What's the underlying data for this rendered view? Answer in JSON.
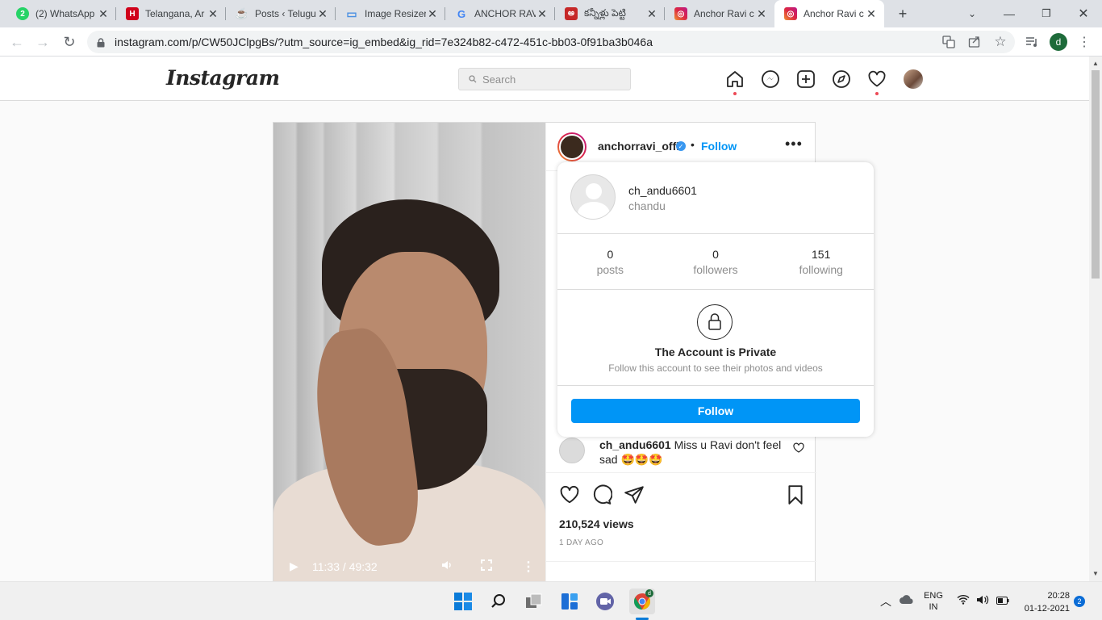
{
  "browser": {
    "tabs": [
      {
        "title": "(2) WhatsApp",
        "icon": "whatsapp-icon",
        "color": "#25d366",
        "glyph": "2"
      },
      {
        "title": "Telangana, Ar",
        "icon": "news-h-icon",
        "color": "#d0021b",
        "glyph": "H"
      },
      {
        "title": "Posts ‹ Telugu",
        "icon": "wordpress-cup-icon",
        "color": "#333333",
        "glyph": "☕"
      },
      {
        "title": "Image Resizer",
        "icon": "image-icon",
        "color": "#4a90e2",
        "glyph": "▭"
      },
      {
        "title": "ANCHOR RAV",
        "icon": "google-icon",
        "color": "#ffffff",
        "glyph": "G"
      },
      {
        "title": "కన్నీళ్లు పెట్టి",
        "icon": "telugu-news-icon",
        "color": "#c62828",
        "glyph": "అ"
      },
      {
        "title": "Anchor Ravi c",
        "icon": "instagram-icon",
        "color": "#e1306c",
        "glyph": "◎"
      },
      {
        "title": "Anchor Ravi c",
        "icon": "instagram-icon",
        "color": "#e1306c",
        "glyph": "◎"
      }
    ],
    "new_tab_glyph": "+",
    "url": "instagram.com/p/CW50JClpgBs/?utm_source=ig_embed&ig_rid=7e324b82-c472-451c-bb03-0f91ba3b046a",
    "profile_initial": "d"
  },
  "instagram": {
    "logo": "Instagram",
    "search_placeholder": "Search",
    "accent": "#0095f6"
  },
  "post": {
    "username": "anchorravi_offl",
    "follow_label": "Follow",
    "bullet": "•",
    "video_time": "11:33 / 49:32",
    "comment_user": "ch_andu6601",
    "comment_text": "Miss u Ravi don't feel sad 🤩🤩🤩",
    "views": "210,524 views",
    "time_ago": "1 DAY AGO"
  },
  "hover_card": {
    "username": "ch_andu6601",
    "full_name": "chandu",
    "stats": [
      {
        "number": "0",
        "label": "posts"
      },
      {
        "number": "0",
        "label": "followers"
      },
      {
        "number": "151",
        "label": "following"
      }
    ],
    "private_title": "The Account is Private",
    "private_subtitle": "Follow this account to see their photos and videos",
    "follow_button": "Follow"
  },
  "taskbar": {
    "lang_top": "ENG",
    "lang_bottom": "IN",
    "time": "20:28",
    "date": "01-12-2021",
    "notification_count": "2"
  }
}
